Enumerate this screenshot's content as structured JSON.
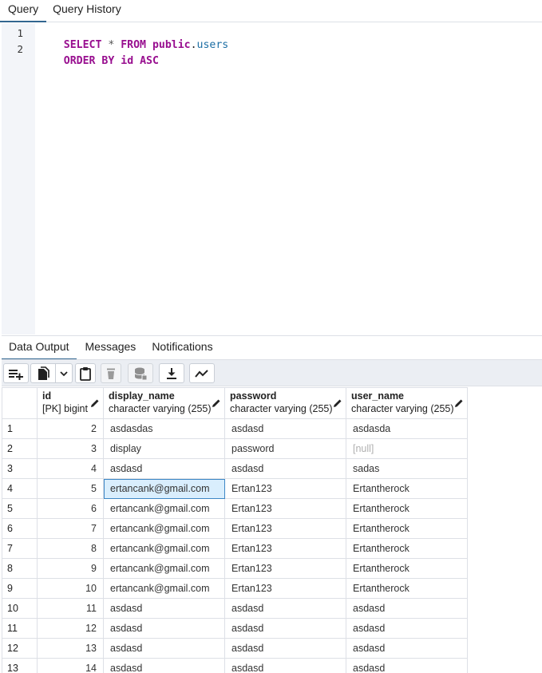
{
  "top_tabs": [
    {
      "label": "Query",
      "active": true
    },
    {
      "label": "Query History",
      "active": false
    }
  ],
  "editor": {
    "lines": [
      {
        "number": "1",
        "tokens": [
          {
            "text": "SELECT",
            "kind": "kw"
          },
          {
            "text": " * ",
            "kind": "op"
          },
          {
            "text": "FROM",
            "kind": "kw"
          },
          {
            "text": " ",
            "kind": "plain"
          },
          {
            "text": "public",
            "kind": "kw"
          },
          {
            "text": ".",
            "kind": "plain"
          },
          {
            "text": "users",
            "kind": "obj"
          }
        ]
      },
      {
        "number": "2",
        "tokens": [
          {
            "text": "ORDER BY",
            "kind": "kw"
          },
          {
            "text": " ",
            "kind": "plain"
          },
          {
            "text": "id",
            "kind": "kw"
          },
          {
            "text": " ",
            "kind": "plain"
          },
          {
            "text": "ASC",
            "kind": "kw"
          }
        ]
      }
    ]
  },
  "panel_tabs": [
    {
      "label": "Data Output",
      "active": true
    },
    {
      "label": "Messages",
      "active": false
    },
    {
      "label": "Notifications",
      "active": false
    }
  ],
  "toolbar": {
    "buttons": [
      {
        "name": "add-row-icon",
        "enabled": true
      },
      {
        "name": "copy-icon",
        "enabled": true
      },
      {
        "name": "chevron-down-icon",
        "enabled": true
      },
      {
        "name": "paste-icon",
        "enabled": true
      },
      {
        "name": "trash-icon",
        "enabled": false
      },
      {
        "name": "save-data-icon",
        "enabled": false
      },
      {
        "name": "download-icon",
        "enabled": true
      },
      {
        "name": "graph-icon",
        "enabled": true
      }
    ]
  },
  "grid": {
    "columns": [
      {
        "name": "id",
        "type": "[PK] bigint"
      },
      {
        "name": "display_name",
        "type": "character varying (255)"
      },
      {
        "name": "password",
        "type": "character varying (255)"
      },
      {
        "name": "user_name",
        "type": "character varying (255)"
      }
    ],
    "null_label": "[null]",
    "rows": [
      {
        "row": "1",
        "id": "2",
        "display_name": "asdasdas",
        "password": "asdasd",
        "user_name": "asdasda"
      },
      {
        "row": "2",
        "id": "3",
        "display_name": "display",
        "password": "password",
        "user_name": null
      },
      {
        "row": "3",
        "id": "4",
        "display_name": "asdasd",
        "password": "asdasd",
        "user_name": "sadas"
      },
      {
        "row": "4",
        "id": "5",
        "display_name": "ertancank@gmail.com",
        "password": "Ertan123",
        "user_name": "Ertantherock",
        "selected": "display_name"
      },
      {
        "row": "5",
        "id": "6",
        "display_name": "ertancank@gmail.com",
        "password": "Ertan123",
        "user_name": "Ertantherock"
      },
      {
        "row": "6",
        "id": "7",
        "display_name": "ertancank@gmail.com",
        "password": "Ertan123",
        "user_name": "Ertantherock"
      },
      {
        "row": "7",
        "id": "8",
        "display_name": "ertancank@gmail.com",
        "password": "Ertan123",
        "user_name": "Ertantherock"
      },
      {
        "row": "8",
        "id": "9",
        "display_name": "ertancank@gmail.com",
        "password": "Ertan123",
        "user_name": "Ertantherock"
      },
      {
        "row": "9",
        "id": "10",
        "display_name": "ertancank@gmail.com",
        "password": "Ertan123",
        "user_name": "Ertantherock"
      },
      {
        "row": "10",
        "id": "11",
        "display_name": "asdasd",
        "password": "asdasd",
        "user_name": "asdasd"
      },
      {
        "row": "11",
        "id": "12",
        "display_name": "asdasd",
        "password": "asdasd",
        "user_name": "asdasd"
      },
      {
        "row": "12",
        "id": "13",
        "display_name": "asdasd",
        "password": "asdasd",
        "user_name": "asdasd"
      },
      {
        "row": "13",
        "id": "14",
        "display_name": "asdasd",
        "password": "asdasd",
        "user_name": "asdasd"
      }
    ]
  }
}
